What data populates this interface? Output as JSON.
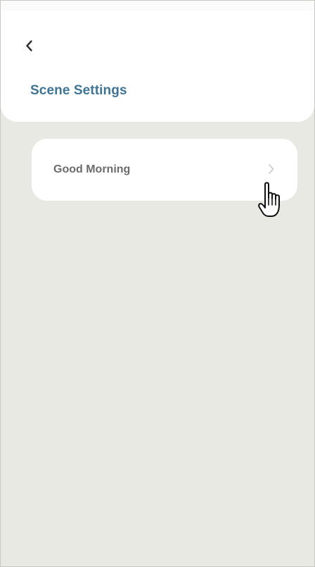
{
  "header": {
    "back_icon": "chevron-left-icon",
    "title": "Scene Settings"
  },
  "scenes": [
    {
      "label": "Good Morning",
      "icon": "chevron-right-icon"
    }
  ],
  "cursor": {
    "icon": "hand-pointer-icon"
  },
  "colors": {
    "background": "#e9e9e4",
    "card": "#ffffff",
    "title": "#3e7494",
    "scene_text": "#6b6b6b",
    "chevron": "#c8c8c8"
  }
}
